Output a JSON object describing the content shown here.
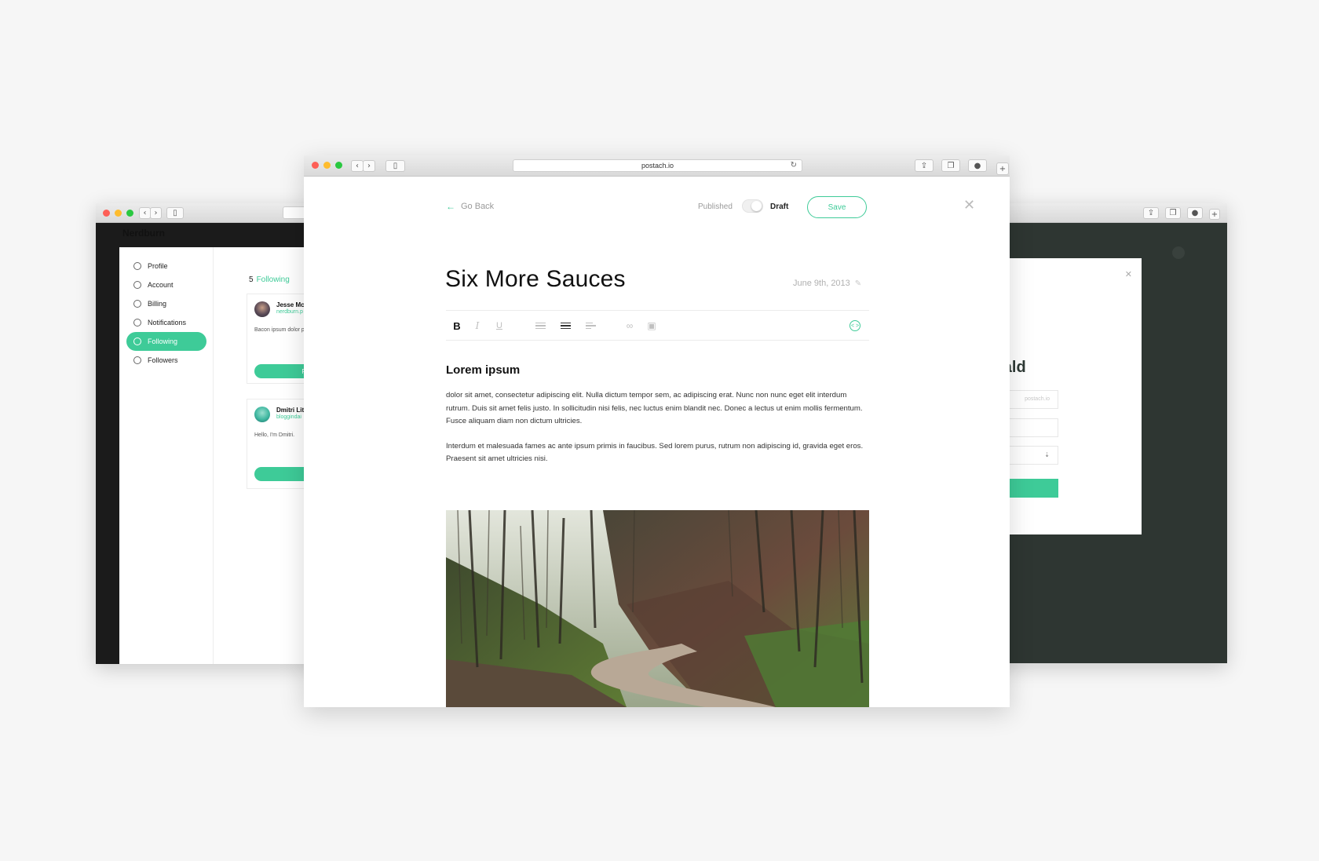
{
  "left_window": {
    "brand": "Nerdburn",
    "nav": [
      {
        "label": "Profile",
        "icon": "user-icon",
        "active": false
      },
      {
        "label": "Account",
        "icon": "dots-icon",
        "active": false
      },
      {
        "label": "Billing",
        "icon": "dollar-icon",
        "active": false
      },
      {
        "label": "Notifications",
        "icon": "bell-icon",
        "active": false
      },
      {
        "label": "Following",
        "icon": "check-circle-icon",
        "active": true
      },
      {
        "label": "Followers",
        "icon": "check-circle-icon",
        "active": false
      }
    ],
    "following_count": "5",
    "following_label": "Following",
    "cards": [
      {
        "name": "Jesse Mc",
        "handle": "nerdburn.p",
        "bio": "Bacon ipsum dolor pork salami swine, burger tail pig kielb",
        "button": "Followin"
      },
      {
        "name": "Dmitri Lit",
        "handle": "bloggindai",
        "bio": "Hello, I'm Dmitri.",
        "button": "Followi"
      }
    ]
  },
  "right_window": {
    "name_fragment": "cdonald",
    "domain_suffix": "postach.io",
    "button_fragment": "re"
  },
  "main_window": {
    "url": "postach.io",
    "go_back": "Go Back",
    "published_label": "Published",
    "draft_label": "Draft",
    "save_label": "Save",
    "title": "Six More Sauces",
    "date": "June 9th, 2013",
    "heading": "Lorem ipsum",
    "paragraphs": [
      "dolor sit amet, consectetur adipiscing elit. Nulla dictum tempor sem, ac adipiscing erat. Nunc non nunc eget elit interdum rutrum. Duis sit amet felis justo. In sollicitudin nisi felis, nec luctus enim blandit nec. Donec a lectus ut enim mollis fermentum. Fusce aliquam diam non dictum ultricies.",
      "Interdum et malesuada fames ac ante ipsum primis in faucibus. Sed lorem purus, rutrum non adipiscing id, gravida eget eros. Praesent sit amet ultricies nisi."
    ],
    "published": false,
    "toolbar": {
      "bold": "B",
      "italic": "I",
      "underline": "U",
      "html": "< >"
    }
  },
  "colors": {
    "accent": "#3ecb98",
    "dark_bg": "#1b1b1b",
    "right_bg": "#2e3632"
  }
}
